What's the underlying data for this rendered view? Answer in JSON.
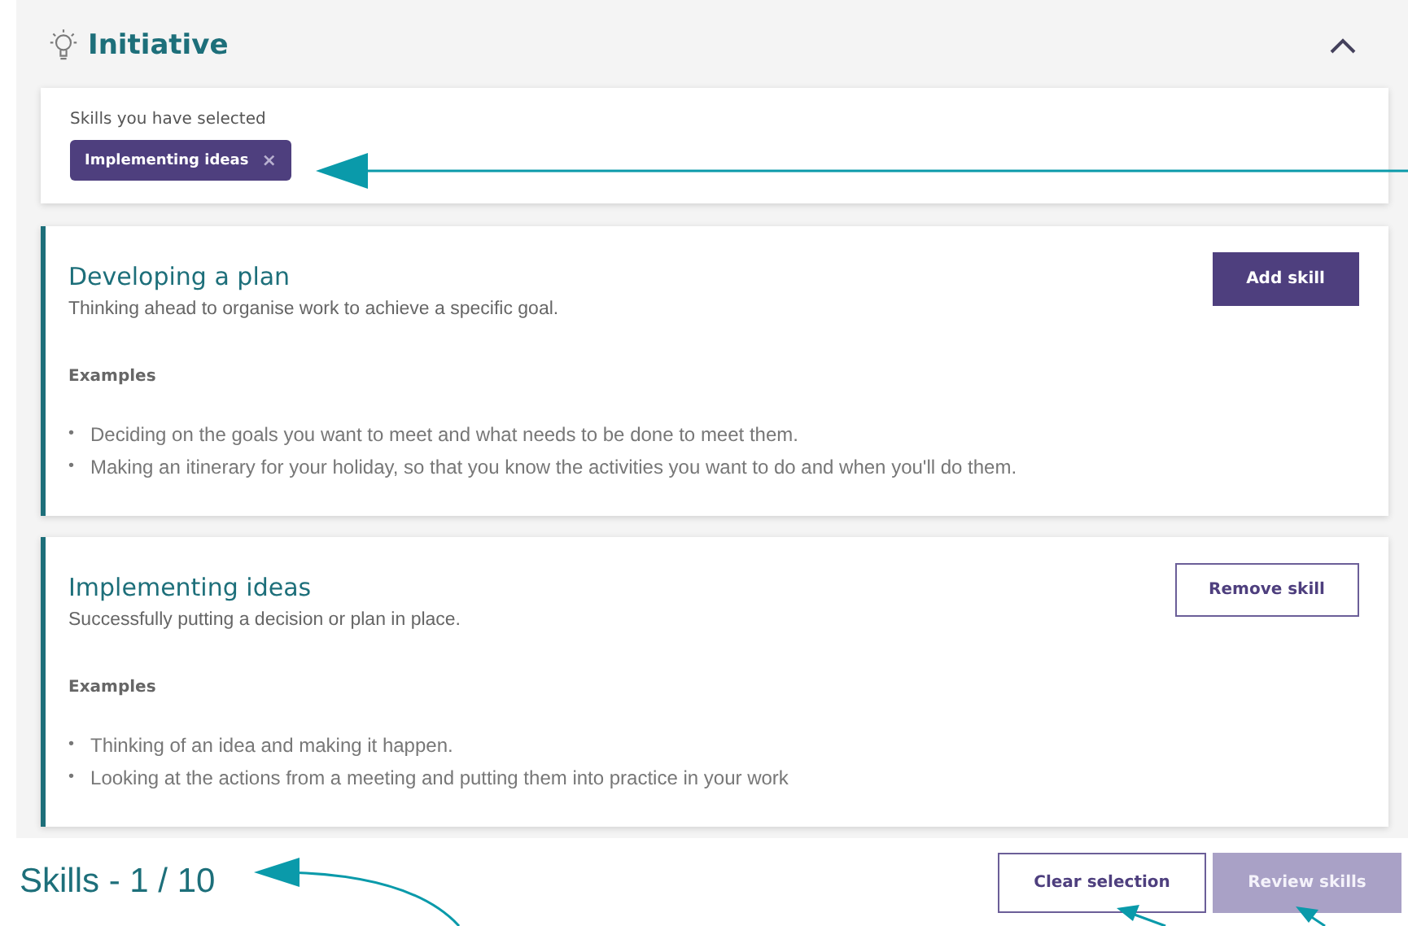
{
  "section": {
    "title": "Initiative",
    "expanded": true
  },
  "selected_panel": {
    "label": "Skills you have selected",
    "tags": [
      {
        "label": "Implementing ideas",
        "remove_glyph": "×"
      }
    ]
  },
  "skills": [
    {
      "title": "Developing a plan",
      "description": "Thinking ahead to organise work to achieve a specific goal.",
      "selected": false,
      "button": "Add skill",
      "bullet": "•",
      "examples_heading": "Examples",
      "examples": [
        "Deciding on the goals you want to meet and what needs to be done to meet them.",
        "Making an itinerary for your holiday, so that you know the activities you want to do and when you'll do them."
      ]
    },
    {
      "title": "Implementing ideas",
      "description": "Successfully putting a decision or plan in place.",
      "selected": true,
      "button": "Remove skill",
      "bullet": "•",
      "examples_heading": "Examples",
      "examples": [
        "Thinking of an idea and making it happen.",
        "Looking at the actions from a meeting and putting them into practice in your work"
      ]
    }
  ],
  "footer": {
    "counter": "Skills - 1 / 10",
    "buttons": [
      {
        "label": "Clear selection",
        "kind": "outline",
        "disabled": false
      },
      {
        "label": "Review skills",
        "kind": "primary",
        "disabled": true
      }
    ]
  }
}
